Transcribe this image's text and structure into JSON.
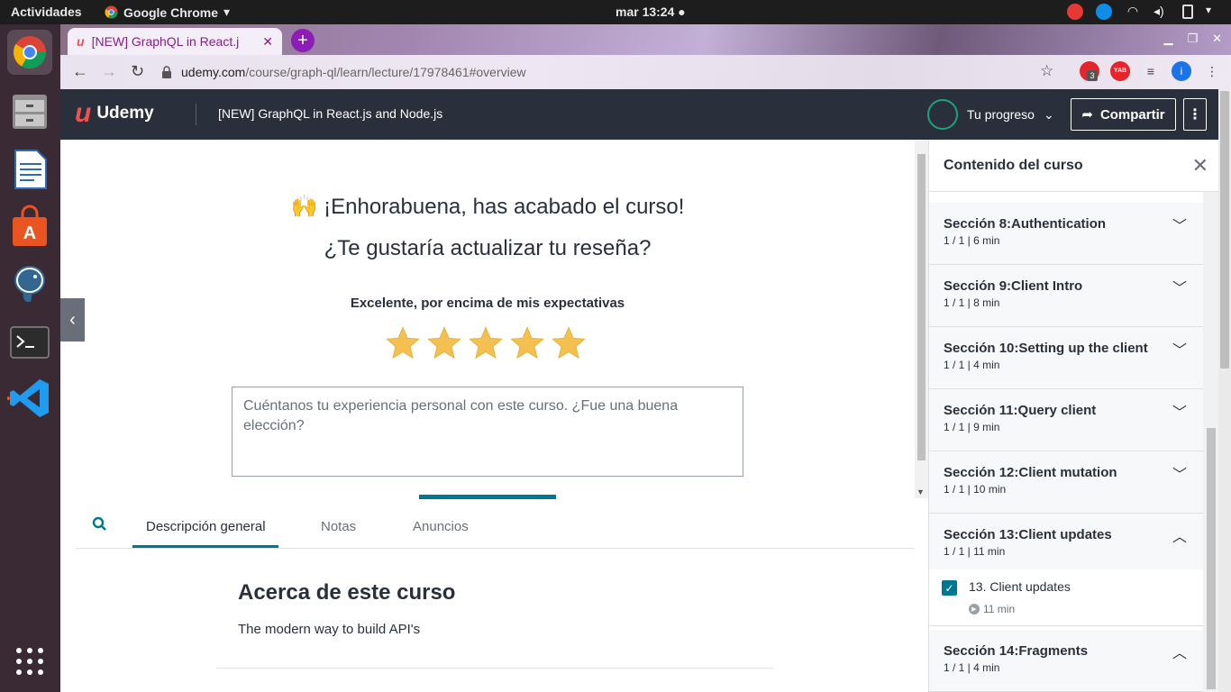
{
  "system": {
    "activities": "Actividades",
    "app_name": "Google Chrome",
    "clock": "mar 13:24 ●"
  },
  "browser": {
    "tab_title": "[NEW] GraphQL in React.j",
    "url_domain": "udemy.com",
    "url_path": "/course/graph-ql/learn/lecture/17978461#overview",
    "ext_badge": "3",
    "ext_yab": "YAB",
    "ext_profile": "i"
  },
  "header": {
    "logo": "Udemy",
    "course_title": "[NEW] GraphQL in React.js and Node.js",
    "progress_label": "Tu progreso",
    "share_label": "Compartir"
  },
  "review": {
    "emoji": "🙌",
    "congrats": "¡Enhorabuena, has acabado el curso!",
    "question": "¿Te gustaría actualizar tu reseña?",
    "rating_label": "Excelente, por encima de mis expectativas",
    "rating": 5,
    "placeholder": "Cuéntanos tu experiencia personal con este curso. ¿Fue una buena elección?"
  },
  "tabs": {
    "items": [
      "Descripción general",
      "Notas",
      "Anuncios"
    ],
    "active": "Descripción general"
  },
  "about": {
    "title": "Acerca de este curso",
    "description": "The modern way to build API's"
  },
  "sidebar": {
    "title": "Contenido del curso",
    "sections": [
      {
        "name": "Sección 8:Authentication",
        "meta": "1 / 1 | 6 min",
        "expanded": false
      },
      {
        "name": "Sección 9:Client Intro",
        "meta": "1 / 1 | 8 min",
        "expanded": false
      },
      {
        "name": "Sección 10:Setting up the client",
        "meta": "1 / 1 | 4 min",
        "expanded": false
      },
      {
        "name": "Sección 11:Query client",
        "meta": "1 / 1 | 9 min",
        "expanded": false
      },
      {
        "name": "Sección 12:Client mutation",
        "meta": "1 / 1 | 10 min",
        "expanded": false
      },
      {
        "name": "Sección 13:Client updates",
        "meta": "1 / 1 | 11 min",
        "expanded": true
      },
      {
        "name": "Sección 14:Fragments",
        "meta": "1 / 1 | 4 min",
        "expanded": true
      }
    ],
    "lecture": {
      "title": "13. Client updates",
      "duration": "11 min",
      "completed": true
    }
  },
  "colors": {
    "accent": "#007791",
    "brand": "#ec5252",
    "header_bg": "#29303b",
    "star": "#f4c150"
  }
}
